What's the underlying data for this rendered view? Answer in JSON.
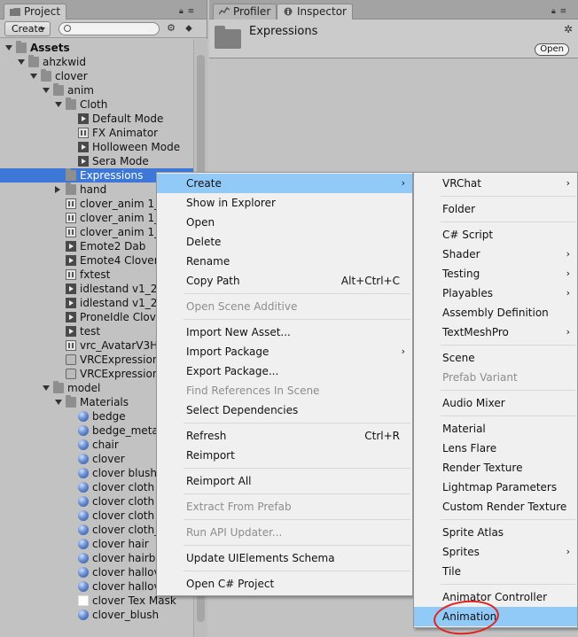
{
  "project_panel": {
    "tab_label": "Project",
    "create_label": "Create",
    "search_placeholder": "",
    "tree": [
      {
        "label": "Assets",
        "depth": 0,
        "arrow": "open",
        "icon": "folder-icon",
        "bold": true
      },
      {
        "label": "ahzkwid",
        "depth": 1,
        "arrow": "open",
        "icon": "folder-icon"
      },
      {
        "label": "clover",
        "depth": 2,
        "arrow": "open",
        "icon": "folder-icon"
      },
      {
        "label": "anim",
        "depth": 3,
        "arrow": "open",
        "icon": "folder-icon"
      },
      {
        "label": "Cloth",
        "depth": 4,
        "arrow": "open",
        "icon": "folder-icon"
      },
      {
        "label": "Default Mode",
        "depth": 5,
        "arrow": "",
        "icon": "animation-clip-icon"
      },
      {
        "label": "FX Animator",
        "depth": 5,
        "arrow": "",
        "icon": "animator-controller-icon"
      },
      {
        "label": "Holloween Mode",
        "depth": 5,
        "arrow": "",
        "icon": "animation-clip-icon"
      },
      {
        "label": "Sera Mode",
        "depth": 5,
        "arrow": "",
        "icon": "animation-clip-icon"
      },
      {
        "label": "Expressions",
        "depth": 4,
        "arrow": "",
        "icon": "folder-icon",
        "selected": true
      },
      {
        "label": "hand",
        "depth": 4,
        "arrow": "closed",
        "icon": "folder-icon"
      },
      {
        "label": "clover_anim 1_",
        "depth": 4,
        "arrow": "",
        "icon": "animator-controller-icon"
      },
      {
        "label": "clover_anim 1_",
        "depth": 4,
        "arrow": "",
        "icon": "animator-controller-icon"
      },
      {
        "label": "clover_anim 1_",
        "depth": 4,
        "arrow": "",
        "icon": "animator-controller-icon"
      },
      {
        "label": "Emote2 Dab",
        "depth": 4,
        "arrow": "",
        "icon": "animation-clip-icon"
      },
      {
        "label": "Emote4 Clover",
        "depth": 4,
        "arrow": "",
        "icon": "animation-clip-icon"
      },
      {
        "label": "fxtest",
        "depth": 4,
        "arrow": "",
        "icon": "animator-controller-icon"
      },
      {
        "label": "idlestand v1_2",
        "depth": 4,
        "arrow": "",
        "icon": "animation-clip-icon"
      },
      {
        "label": "idlestand v1_2",
        "depth": 4,
        "arrow": "",
        "icon": "animation-clip-icon"
      },
      {
        "label": "ProneIdle Clov",
        "depth": 4,
        "arrow": "",
        "icon": "animation-clip-icon"
      },
      {
        "label": "test",
        "depth": 4,
        "arrow": "",
        "icon": "animation-clip-icon"
      },
      {
        "label": "vrc_AvatarV3H",
        "depth": 4,
        "arrow": "",
        "icon": "animator-controller-icon"
      },
      {
        "label": "VRCExpression",
        "depth": 4,
        "arrow": "",
        "icon": "asset-icon"
      },
      {
        "label": "VRCExpression",
        "depth": 4,
        "arrow": "",
        "icon": "asset-icon"
      },
      {
        "label": "model",
        "depth": 3,
        "arrow": "open",
        "icon": "folder-icon"
      },
      {
        "label": "Materials",
        "depth": 4,
        "arrow": "open",
        "icon": "folder-icon"
      },
      {
        "label": "bedge",
        "depth": 5,
        "arrow": "",
        "icon": "material-icon"
      },
      {
        "label": "bedge_meta",
        "depth": 5,
        "arrow": "",
        "icon": "material-icon"
      },
      {
        "label": "chair",
        "depth": 5,
        "arrow": "",
        "icon": "material-icon"
      },
      {
        "label": "clover",
        "depth": 5,
        "arrow": "",
        "icon": "material-icon"
      },
      {
        "label": "clover blush",
        "depth": 5,
        "arrow": "",
        "icon": "material-icon"
      },
      {
        "label": "clover cloth",
        "depth": 5,
        "arrow": "",
        "icon": "material-icon"
      },
      {
        "label": "clover cloth",
        "depth": 5,
        "arrow": "",
        "icon": "material-icon"
      },
      {
        "label": "clover cloth",
        "depth": 5,
        "arrow": "",
        "icon": "material-icon"
      },
      {
        "label": "clover cloth_",
        "depth": 5,
        "arrow": "",
        "icon": "material-icon"
      },
      {
        "label": "clover hair",
        "depth": 5,
        "arrow": "",
        "icon": "material-icon"
      },
      {
        "label": "clover hairb",
        "depth": 5,
        "arrow": "",
        "icon": "material-icon"
      },
      {
        "label": "clover hallov",
        "depth": 5,
        "arrow": "",
        "icon": "material-icon"
      },
      {
        "label": "clover hallov",
        "depth": 5,
        "arrow": "",
        "icon": "material-icon"
      },
      {
        "label": "clover Tex Mask",
        "depth": 5,
        "arrow": "",
        "icon": "texture-icon"
      },
      {
        "label": "clover_blush",
        "depth": 5,
        "arrow": "",
        "icon": "material-icon"
      }
    ]
  },
  "inspector": {
    "tabs": [
      {
        "label": "Profiler",
        "icon": "profiler-icon"
      },
      {
        "label": "Inspector",
        "icon": "info-icon"
      }
    ],
    "title": "Expressions",
    "open_label": "Open"
  },
  "context_menu": [
    {
      "label": "Create",
      "highlight": true,
      "submenu": true
    },
    {
      "label": "Show in Explorer"
    },
    {
      "label": "Open"
    },
    {
      "label": "Delete"
    },
    {
      "label": "Rename"
    },
    {
      "label": "Copy Path",
      "shortcut": "Alt+Ctrl+C"
    },
    {
      "separator": true
    },
    {
      "label": "Open Scene Additive",
      "disabled": true
    },
    {
      "separator": true
    },
    {
      "label": "Import New Asset..."
    },
    {
      "label": "Import Package",
      "submenu": true
    },
    {
      "label": "Export Package..."
    },
    {
      "label": "Find References In Scene",
      "disabled": true
    },
    {
      "label": "Select Dependencies"
    },
    {
      "separator": true
    },
    {
      "label": "Refresh",
      "shortcut": "Ctrl+R"
    },
    {
      "label": "Reimport"
    },
    {
      "separator": true
    },
    {
      "label": "Reimport All"
    },
    {
      "separator": true
    },
    {
      "label": "Extract From Prefab",
      "disabled": true
    },
    {
      "separator": true
    },
    {
      "label": "Run API Updater...",
      "disabled": true
    },
    {
      "separator": true
    },
    {
      "label": "Update UIElements Schema"
    },
    {
      "separator": true
    },
    {
      "label": "Open C# Project"
    }
  ],
  "create_submenu": [
    {
      "label": "VRChat",
      "submenu": true
    },
    {
      "separator": true
    },
    {
      "label": "Folder"
    },
    {
      "separator": true
    },
    {
      "label": "C# Script"
    },
    {
      "label": "Shader",
      "submenu": true
    },
    {
      "label": "Testing",
      "submenu": true
    },
    {
      "label": "Playables",
      "submenu": true
    },
    {
      "label": "Assembly Definition"
    },
    {
      "label": "TextMeshPro",
      "submenu": true
    },
    {
      "separator": true
    },
    {
      "label": "Scene"
    },
    {
      "label": "Prefab Variant",
      "disabled": true
    },
    {
      "separator": true
    },
    {
      "label": "Audio Mixer"
    },
    {
      "separator": true
    },
    {
      "label": "Material"
    },
    {
      "label": "Lens Flare"
    },
    {
      "label": "Render Texture"
    },
    {
      "label": "Lightmap Parameters"
    },
    {
      "label": "Custom Render Texture"
    },
    {
      "separator": true
    },
    {
      "label": "Sprite Atlas"
    },
    {
      "label": "Sprites",
      "submenu": true
    },
    {
      "label": "Tile"
    },
    {
      "separator": true
    },
    {
      "label": "Animator Controller"
    },
    {
      "label": "Animation",
      "highlight": true
    }
  ],
  "colors": {
    "selection": "#3d78d8",
    "menu_highlight": "#91c9f7",
    "annotation": "#e0231f"
  }
}
